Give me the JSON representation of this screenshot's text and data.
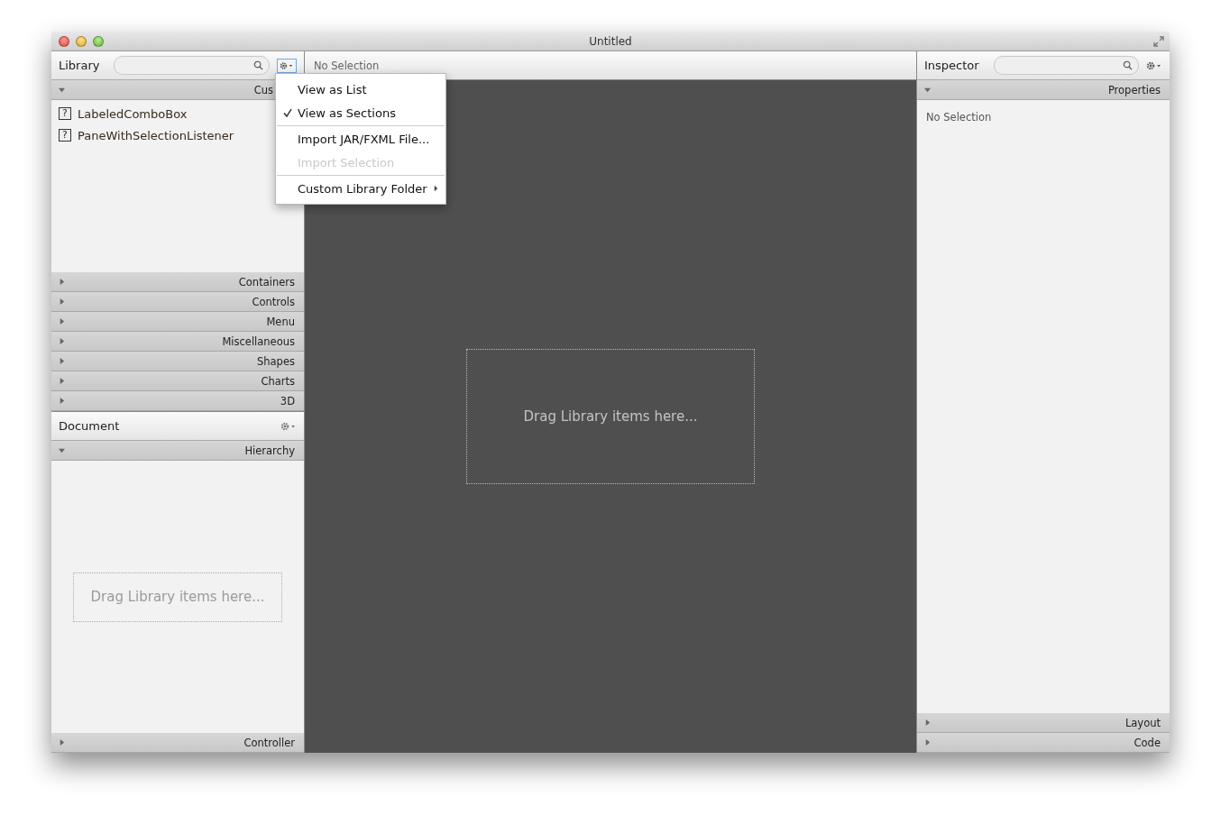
{
  "window": {
    "title": "Untitled"
  },
  "library": {
    "title": "Library",
    "sections": [
      {
        "label": "Cus",
        "expanded": true,
        "items": [
          {
            "icon": "?",
            "label": "LabeledComboBox"
          },
          {
            "icon": "?",
            "label": "PaneWithSelectionListener"
          }
        ]
      },
      {
        "label": "Containers",
        "expanded": false
      },
      {
        "label": "Controls",
        "expanded": false
      },
      {
        "label": "Menu",
        "expanded": false
      },
      {
        "label": "Miscellaneous",
        "expanded": false
      },
      {
        "label": "Shapes",
        "expanded": false
      },
      {
        "label": "Charts",
        "expanded": false
      },
      {
        "label": "3D",
        "expanded": false
      }
    ]
  },
  "library_menu": [
    {
      "kind": "item",
      "label": "View as List",
      "checked": false,
      "disabled": false
    },
    {
      "kind": "item",
      "label": "View as Sections",
      "checked": true,
      "disabled": false
    },
    {
      "kind": "separator"
    },
    {
      "kind": "item",
      "label": "Import JAR/FXML File...",
      "checked": false,
      "disabled": false
    },
    {
      "kind": "item",
      "label": "Import Selection",
      "checked": false,
      "disabled": true
    },
    {
      "kind": "separator"
    },
    {
      "kind": "submenu",
      "label": "Custom Library Folder",
      "checked": false,
      "disabled": false
    }
  ],
  "document": {
    "title": "Document",
    "sections": [
      {
        "label": "Hierarchy",
        "expanded": true
      }
    ],
    "drop_hint": "Drag Library items here...",
    "footer": {
      "label": "Controller",
      "expanded": false
    }
  },
  "canvas": {
    "selection": "No Selection",
    "drop_hint": "Drag Library items here..."
  },
  "inspector": {
    "title": "Inspector",
    "sections": [
      {
        "label": "Properties",
        "expanded": true
      }
    ],
    "empty": "No Selection",
    "footer_sections": [
      {
        "label": "Layout",
        "expanded": false
      },
      {
        "label": "Code",
        "expanded": false
      }
    ]
  }
}
